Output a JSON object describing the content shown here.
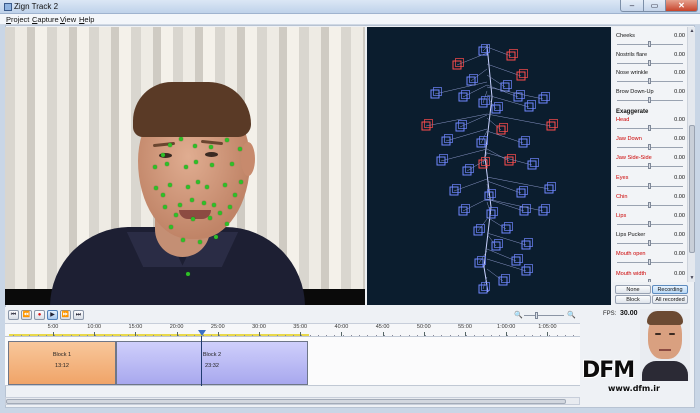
{
  "window": {
    "title": "Zign Track 2",
    "min": "–",
    "max": "▭",
    "close": "✕"
  },
  "menu": [
    "Project",
    "Capture",
    "View",
    "Help"
  ],
  "sliders": {
    "items": [
      {
        "label": "Cheeks",
        "value": "0.00",
        "red": false,
        "pos": 0.5
      },
      {
        "label": "Nostrils flare",
        "value": "0.00",
        "red": false,
        "pos": 0.5
      },
      {
        "label": "Nose wrinkle",
        "value": "0.00",
        "red": false,
        "pos": 0.5
      },
      {
        "label": "Brow Down-Up",
        "value": "0.00",
        "red": false,
        "pos": 0.5
      }
    ],
    "section": "Exaggerate",
    "exaggerate": [
      {
        "label": "Head",
        "value": "0.00",
        "red": true,
        "pos": 0.5
      },
      {
        "label": "Jaw Down",
        "value": "0.00",
        "red": true,
        "pos": 0.5
      },
      {
        "label": "Jaw Side-Side",
        "value": "0.00",
        "red": true,
        "pos": 0.5
      },
      {
        "label": "Eyes",
        "value": "0.00",
        "red": true,
        "pos": 0.5
      },
      {
        "label": "Chin",
        "value": "0.00",
        "red": true,
        "pos": 0.5
      },
      {
        "label": "Lips",
        "value": "0.00",
        "red": true,
        "pos": 0.5
      },
      {
        "label": "Lips Pucker",
        "value": "0.00",
        "red": false,
        "pos": 0.5
      },
      {
        "label": "Mouth open",
        "value": "0.00",
        "red": true,
        "pos": 0.5
      },
      {
        "label": "Mouth width",
        "value": "0.00",
        "red": true,
        "pos": 0.5
      }
    ]
  },
  "panel_buttons": {
    "none": "None",
    "recording": "Recording",
    "block": "Block",
    "all_recorded": "All recorded"
  },
  "transport": {
    "fps_label": "FPS:",
    "fps_value": "30.00"
  },
  "timeline": {
    "labels": [
      "5:00",
      "10:00",
      "15:00",
      "20:00",
      "25:00",
      "30:00",
      "35:00",
      "40:00",
      "45:00",
      "50:00",
      "55:00",
      "1:00:00",
      "1:05:00"
    ],
    "blocks": [
      {
        "name": "Block 1",
        "time": "13:12"
      },
      {
        "name": "Block 2",
        "time": "23:32"
      }
    ]
  },
  "watermark": {
    "logo": "DFM",
    "url": "www.dfm.ir"
  },
  "colors": {
    "tracking_dot": "#2fbf28",
    "mesh_blue": "#6f86ff",
    "mesh_red": "#ff4d4d",
    "viewport_bg": "#0b1d2e",
    "block1": "#f0a468",
    "block2": "#a8a8ee"
  }
}
